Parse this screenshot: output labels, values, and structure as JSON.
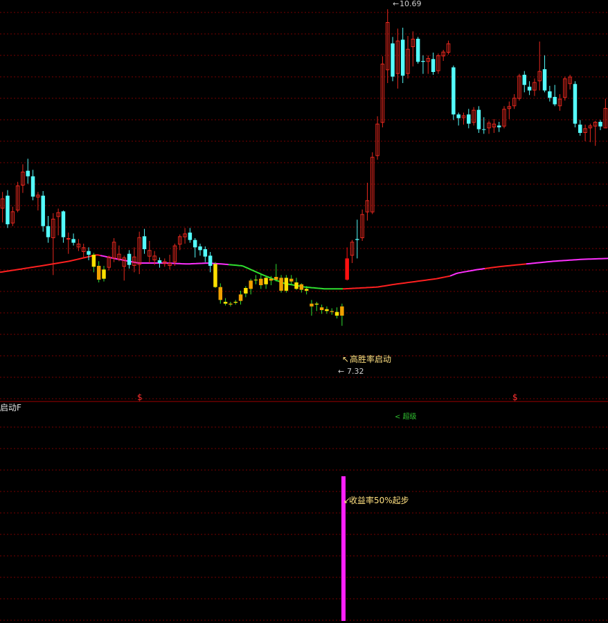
{
  "chart_data": {
    "type": "candlestick",
    "price_range": [
      6.5,
      10.85
    ],
    "indicator_range": [
      0,
      100
    ],
    "colors": {
      "up": "#e8281e",
      "down": "#54fcfc",
      "highlight_up": "#ff1010",
      "highlight_yellow": "#ffe000",
      "highlight_orange": "#f0a000",
      "ma_red": "#ff2020",
      "ma_magenta": "#ff30ff",
      "ma_green": "#30e030",
      "indicator_bar": "#ff20ff",
      "grid": "#7a0000",
      "divider": "#a00000",
      "label_text": "#ffe080",
      "axis_text": "#d0d0d0"
    },
    "max_label": "10.69",
    "min_label": "7.32",
    "signal_label": "高胜率启动",
    "indicator_label": "收益率50%起步",
    "lower_panel_title": "启动F",
    "lower_panel_note": "< 超级",
    "dollar_marks": [
      "$",
      "$"
    ],
    "indicator_value": 100,
    "candles": [
      {
        "o": 8.59,
        "h": 8.77,
        "l": 8.44,
        "c": 8.7,
        "cls": "up"
      },
      {
        "o": 8.73,
        "h": 8.79,
        "l": 8.38,
        "c": 8.42,
        "cls": "down"
      },
      {
        "o": 8.43,
        "h": 8.61,
        "l": 8.4,
        "c": 8.56,
        "cls": "up"
      },
      {
        "o": 8.57,
        "h": 8.88,
        "l": 8.55,
        "c": 8.84,
        "cls": "up"
      },
      {
        "o": 8.84,
        "h": 9.07,
        "l": 8.76,
        "c": 8.99,
        "cls": "up"
      },
      {
        "o": 9.0,
        "h": 9.13,
        "l": 8.86,
        "c": 8.94,
        "cls": "down"
      },
      {
        "o": 8.94,
        "h": 9.01,
        "l": 8.68,
        "c": 8.72,
        "cls": "down"
      },
      {
        "o": 8.71,
        "h": 8.77,
        "l": 8.57,
        "c": 8.74,
        "cls": "up"
      },
      {
        "o": 8.73,
        "h": 8.78,
        "l": 8.34,
        "c": 8.4,
        "cls": "down"
      },
      {
        "o": 8.4,
        "h": 8.51,
        "l": 8.22,
        "c": 8.28,
        "cls": "down"
      },
      {
        "o": 8.27,
        "h": 8.54,
        "l": 7.87,
        "c": 8.48,
        "cls": "up"
      },
      {
        "o": 8.5,
        "h": 8.59,
        "l": 8.3,
        "c": 8.55,
        "cls": "up"
      },
      {
        "o": 8.56,
        "h": 8.57,
        "l": 8.22,
        "c": 8.28,
        "cls": "down"
      },
      {
        "o": 8.27,
        "h": 8.33,
        "l": 8.1,
        "c": 8.26,
        "cls": "up"
      },
      {
        "o": 8.26,
        "h": 8.32,
        "l": 8.19,
        "c": 8.22,
        "cls": "down"
      },
      {
        "o": 8.21,
        "h": 8.26,
        "l": 8.13,
        "c": 8.17,
        "cls": "up"
      },
      {
        "o": 8.17,
        "h": 8.21,
        "l": 8.05,
        "c": 8.12,
        "cls": "up"
      },
      {
        "o": 8.13,
        "h": 8.17,
        "l": 8.03,
        "c": 8.09,
        "cls": "down"
      },
      {
        "o": 8.09,
        "h": 8.11,
        "l": 7.9,
        "c": 7.96,
        "cls": "hy"
      },
      {
        "o": 7.97,
        "h": 8.02,
        "l": 7.79,
        "c": 7.82,
        "cls": "hy"
      },
      {
        "o": 7.83,
        "h": 7.97,
        "l": 7.8,
        "c": 7.93,
        "cls": "hy"
      },
      {
        "o": 7.95,
        "h": 8.08,
        "l": 7.92,
        "c": 8.07,
        "cls": "up"
      },
      {
        "o": 8.05,
        "h": 8.27,
        "l": 8.01,
        "c": 8.23,
        "cls": "up"
      },
      {
        "o": 8.1,
        "h": 8.19,
        "l": 8.02,
        "c": 8.04,
        "cls": "up"
      },
      {
        "o": 8.06,
        "h": 8.08,
        "l": 7.81,
        "c": 7.96,
        "cls": "up"
      },
      {
        "o": 7.98,
        "h": 8.14,
        "l": 7.94,
        "c": 8.1,
        "cls": "down"
      },
      {
        "o": 8.07,
        "h": 8.17,
        "l": 7.9,
        "c": 7.97,
        "cls": "up"
      },
      {
        "o": 7.98,
        "h": 8.34,
        "l": 7.88,
        "c": 8.28,
        "cls": "up"
      },
      {
        "o": 8.29,
        "h": 8.37,
        "l": 8.1,
        "c": 8.15,
        "cls": "down"
      },
      {
        "o": 8.14,
        "h": 8.24,
        "l": 8.0,
        "c": 8.07,
        "cls": "up"
      },
      {
        "o": 8.08,
        "h": 8.13,
        "l": 7.98,
        "c": 8.03,
        "cls": "up"
      },
      {
        "o": 8.0,
        "h": 8.06,
        "l": 7.95,
        "c": 8.03,
        "cls": "down"
      },
      {
        "o": 8.02,
        "h": 8.05,
        "l": 7.96,
        "c": 7.99,
        "cls": "up"
      },
      {
        "o": 7.97,
        "h": 8.09,
        "l": 7.93,
        "c": 8.0,
        "cls": "up"
      },
      {
        "o": 8.01,
        "h": 8.21,
        "l": 7.97,
        "c": 8.19,
        "cls": "up"
      },
      {
        "o": 8.2,
        "h": 8.31,
        "l": 8.14,
        "c": 8.29,
        "cls": "up"
      },
      {
        "o": 8.28,
        "h": 8.38,
        "l": 8.21,
        "c": 8.32,
        "cls": "up"
      },
      {
        "o": 8.33,
        "h": 8.38,
        "l": 8.22,
        "c": 8.25,
        "cls": "down"
      },
      {
        "o": 8.25,
        "h": 8.27,
        "l": 8.06,
        "c": 8.17,
        "cls": "down"
      },
      {
        "o": 8.18,
        "h": 8.21,
        "l": 8.08,
        "c": 8.14,
        "cls": "down"
      },
      {
        "o": 8.15,
        "h": 8.18,
        "l": 8.01,
        "c": 8.07,
        "cls": "down"
      },
      {
        "o": 8.08,
        "h": 8.12,
        "l": 7.9,
        "c": 7.97,
        "cls": "down"
      },
      {
        "o": 7.99,
        "h": 8.01,
        "l": 7.73,
        "c": 7.74,
        "cls": "hy"
      },
      {
        "o": 7.74,
        "h": 7.78,
        "l": 7.56,
        "c": 7.6,
        "cls": "hy"
      },
      {
        "o": 7.58,
        "h": 7.62,
        "l": 7.54,
        "c": 7.56,
        "cls": "hy"
      },
      {
        "o": 7.55,
        "h": 7.58,
        "l": 7.53,
        "c": 7.56,
        "cls": "hy"
      },
      {
        "o": 7.57,
        "h": 7.6,
        "l": 7.55,
        "c": 7.58,
        "cls": "hy"
      },
      {
        "o": 7.59,
        "h": 7.7,
        "l": 7.55,
        "c": 7.66,
        "cls": "hy"
      },
      {
        "o": 7.67,
        "h": 7.75,
        "l": 7.63,
        "c": 7.73,
        "cls": "hy"
      },
      {
        "o": 7.72,
        "h": 7.83,
        "l": 7.66,
        "c": 7.81,
        "cls": "hy"
      },
      {
        "o": 7.82,
        "h": 7.87,
        "l": 7.77,
        "c": 7.82,
        "cls": "hy"
      },
      {
        "o": 7.83,
        "h": 7.88,
        "l": 7.72,
        "c": 7.76,
        "cls": "hy"
      },
      {
        "o": 7.77,
        "h": 7.85,
        "l": 7.72,
        "c": 7.84,
        "cls": "hy"
      },
      {
        "o": 7.83,
        "h": 7.86,
        "l": 7.76,
        "c": 7.81,
        "cls": "hy"
      },
      {
        "o": 7.82,
        "h": 7.99,
        "l": 7.8,
        "c": 7.85,
        "cls": "ho"
      },
      {
        "o": 7.84,
        "h": 7.87,
        "l": 7.68,
        "c": 7.7,
        "cls": "hy"
      },
      {
        "o": 7.7,
        "h": 7.87,
        "l": 7.68,
        "c": 7.84,
        "cls": "hy"
      },
      {
        "o": 7.83,
        "h": 7.87,
        "l": 7.76,
        "c": 7.8,
        "cls": "hy"
      },
      {
        "o": 7.79,
        "h": 7.84,
        "l": 7.71,
        "c": 7.72,
        "cls": "hy"
      },
      {
        "o": 7.71,
        "h": 7.78,
        "l": 7.68,
        "c": 7.77,
        "cls": "hy"
      },
      {
        "o": 7.72,
        "h": 7.75,
        "l": 7.66,
        "c": 7.7,
        "cls": "hy"
      },
      {
        "o": 7.56,
        "h": 7.6,
        "l": 7.43,
        "c": 7.53,
        "cls": "hy"
      },
      {
        "o": 7.56,
        "h": 7.58,
        "l": 7.48,
        "c": 7.55,
        "cls": "hy"
      },
      {
        "o": 7.52,
        "h": 7.55,
        "l": 7.45,
        "c": 7.49,
        "cls": "hy"
      },
      {
        "o": 7.5,
        "h": 7.53,
        "l": 7.45,
        "c": 7.48,
        "cls": "hy"
      },
      {
        "o": 7.48,
        "h": 7.51,
        "l": 7.44,
        "c": 7.47,
        "cls": "hy"
      },
      {
        "o": 7.47,
        "h": 7.52,
        "l": 7.4,
        "c": 7.43,
        "cls": "hy"
      },
      {
        "o": 7.43,
        "h": 7.56,
        "l": 7.32,
        "c": 7.53,
        "cls": "hy"
      },
      {
        "o": 7.82,
        "h": 8.17,
        "l": 7.81,
        "c": 8.05,
        "cls": "hr"
      },
      {
        "o": 8.08,
        "h": 8.25,
        "l": 8.0,
        "c": 8.23,
        "cls": "up"
      },
      {
        "o": 8.26,
        "h": 8.47,
        "l": 8.05,
        "c": 8.25,
        "cls": "down"
      },
      {
        "o": 8.27,
        "h": 8.58,
        "l": 8.24,
        "c": 8.53,
        "cls": "up"
      },
      {
        "o": 8.55,
        "h": 8.87,
        "l": 8.46,
        "c": 8.68,
        "cls": "up"
      },
      {
        "o": 8.55,
        "h": 9.2,
        "l": 8.53,
        "c": 9.15,
        "cls": "up"
      },
      {
        "o": 9.16,
        "h": 9.59,
        "l": 9.12,
        "c": 9.51,
        "cls": "up"
      },
      {
        "o": 9.52,
        "h": 10.24,
        "l": 9.47,
        "c": 10.16,
        "cls": "up"
      },
      {
        "o": 10.09,
        "h": 10.75,
        "l": 9.95,
        "c": 10.61,
        "cls": "up"
      },
      {
        "o": 10.38,
        "h": 10.45,
        "l": 9.97,
        "c": 10.02,
        "cls": "down"
      },
      {
        "o": 10.05,
        "h": 10.54,
        "l": 9.89,
        "c": 10.41,
        "cls": "up"
      },
      {
        "o": 10.42,
        "h": 10.55,
        "l": 9.95,
        "c": 10.03,
        "cls": "down"
      },
      {
        "o": 10.05,
        "h": 10.46,
        "l": 10.0,
        "c": 10.32,
        "cls": "up"
      },
      {
        "o": 10.34,
        "h": 10.51,
        "l": 10.13,
        "c": 10.43,
        "cls": "up"
      },
      {
        "o": 10.43,
        "h": 10.45,
        "l": 10.16,
        "c": 10.18,
        "cls": "down"
      },
      {
        "o": 10.18,
        "h": 10.25,
        "l": 10.05,
        "c": 10.19,
        "cls": "down"
      },
      {
        "o": 10.18,
        "h": 10.25,
        "l": 10.05,
        "c": 10.22,
        "cls": "up"
      },
      {
        "o": 10.21,
        "h": 10.28,
        "l": 10.04,
        "c": 10.07,
        "cls": "down"
      },
      {
        "o": 10.08,
        "h": 10.27,
        "l": 10.05,
        "c": 10.25,
        "cls": "up"
      },
      {
        "o": 10.24,
        "h": 10.31,
        "l": 10.19,
        "c": 10.29,
        "cls": "up"
      },
      {
        "o": 10.28,
        "h": 10.41,
        "l": 10.26,
        "c": 10.38,
        "cls": "up"
      },
      {
        "o": 10.12,
        "h": 10.14,
        "l": 9.55,
        "c": 9.61,
        "cls": "down"
      },
      {
        "o": 9.61,
        "h": 9.63,
        "l": 9.49,
        "c": 9.57,
        "cls": "down"
      },
      {
        "o": 9.57,
        "h": 9.63,
        "l": 9.5,
        "c": 9.6,
        "cls": "up"
      },
      {
        "o": 9.61,
        "h": 9.67,
        "l": 9.46,
        "c": 9.51,
        "cls": "down"
      },
      {
        "o": 9.52,
        "h": 9.69,
        "l": 9.49,
        "c": 9.66,
        "cls": "up"
      },
      {
        "o": 9.66,
        "h": 9.7,
        "l": 9.41,
        "c": 9.45,
        "cls": "down"
      },
      {
        "o": 9.45,
        "h": 9.58,
        "l": 9.4,
        "c": 9.45,
        "cls": "down"
      },
      {
        "o": 9.46,
        "h": 9.54,
        "l": 9.4,
        "c": 9.52,
        "cls": "up"
      },
      {
        "o": 9.51,
        "h": 9.56,
        "l": 9.41,
        "c": 9.47,
        "cls": "up"
      },
      {
        "o": 9.47,
        "h": 9.53,
        "l": 9.42,
        "c": 9.49,
        "cls": "down"
      },
      {
        "o": 9.48,
        "h": 9.7,
        "l": 9.46,
        "c": 9.67,
        "cls": "up"
      },
      {
        "o": 9.67,
        "h": 9.75,
        "l": 9.56,
        "c": 9.7,
        "cls": "up"
      },
      {
        "o": 9.7,
        "h": 9.83,
        "l": 9.67,
        "c": 9.79,
        "cls": "up"
      },
      {
        "o": 9.78,
        "h": 10.05,
        "l": 9.76,
        "c": 10.03,
        "cls": "up"
      },
      {
        "o": 10.04,
        "h": 10.08,
        "l": 9.85,
        "c": 9.93,
        "cls": "down"
      },
      {
        "o": 9.91,
        "h": 9.97,
        "l": 9.82,
        "c": 9.87,
        "cls": "down"
      },
      {
        "o": 9.87,
        "h": 10.0,
        "l": 9.81,
        "c": 9.96,
        "cls": "up"
      },
      {
        "o": 9.97,
        "h": 10.4,
        "l": 9.87,
        "c": 10.08,
        "cls": "up"
      },
      {
        "o": 10.1,
        "h": 10.25,
        "l": 9.85,
        "c": 9.87,
        "cls": "down"
      },
      {
        "o": 9.86,
        "h": 9.92,
        "l": 9.75,
        "c": 9.79,
        "cls": "down"
      },
      {
        "o": 9.8,
        "h": 9.93,
        "l": 9.7,
        "c": 9.72,
        "cls": "down"
      },
      {
        "o": 9.7,
        "h": 9.83,
        "l": 9.65,
        "c": 9.78,
        "cls": "up"
      },
      {
        "o": 9.79,
        "h": 10.02,
        "l": 9.76,
        "c": 10.0,
        "cls": "up"
      },
      {
        "o": 10.02,
        "h": 10.04,
        "l": 9.88,
        "c": 9.94,
        "cls": "up"
      },
      {
        "o": 9.94,
        "h": 9.97,
        "l": 9.47,
        "c": 9.51,
        "cls": "down"
      },
      {
        "o": 9.5,
        "h": 9.55,
        "l": 9.38,
        "c": 9.41,
        "cls": "down"
      },
      {
        "o": 9.41,
        "h": 9.5,
        "l": 9.32,
        "c": 9.46,
        "cls": "up"
      },
      {
        "o": 9.46,
        "h": 9.51,
        "l": 9.31,
        "c": 9.49,
        "cls": "up"
      },
      {
        "o": 9.48,
        "h": 9.54,
        "l": 9.27,
        "c": 9.53,
        "cls": "up"
      },
      {
        "o": 9.53,
        "h": 9.55,
        "l": 9.44,
        "c": 9.48,
        "cls": "down"
      },
      {
        "o": 9.46,
        "h": 9.78,
        "l": 9.46,
        "c": 9.68,
        "cls": "up"
      }
    ],
    "ma_points": [
      [
        0,
        7.9
      ],
      [
        60,
        7.97
      ],
      [
        100,
        8.02
      ],
      [
        140,
        8.09
      ],
      [
        165,
        8.05
      ],
      [
        200,
        8.0
      ],
      [
        240,
        8.0
      ],
      [
        270,
        7.99
      ],
      [
        300,
        8.0
      ],
      [
        320,
        7.99
      ],
      [
        350,
        7.97
      ],
      [
        380,
        7.87
      ],
      [
        410,
        7.78
      ],
      [
        440,
        7.74
      ],
      [
        470,
        7.72
      ],
      [
        495,
        7.72
      ],
      [
        520,
        7.73
      ],
      [
        545,
        7.74
      ],
      [
        570,
        7.77
      ],
      [
        600,
        7.8
      ],
      [
        630,
        7.83
      ],
      [
        650,
        7.86
      ],
      [
        660,
        7.89
      ],
      [
        690,
        7.93
      ],
      [
        720,
        7.96
      ],
      [
        760,
        7.99
      ],
      [
        800,
        8.02
      ],
      [
        840,
        8.04
      ],
      [
        878,
        8.05
      ]
    ],
    "ma_segments": [
      {
        "from": 0,
        "to": 145,
        "cls": "red"
      },
      {
        "from": 145,
        "to": 330,
        "cls": "magenta"
      },
      {
        "from": 330,
        "to": 495,
        "cls": "green"
      },
      {
        "from": 495,
        "to": 650,
        "cls": "red"
      },
      {
        "from": 650,
        "to": 700,
        "cls": "magenta"
      },
      {
        "from": 700,
        "to": 760,
        "cls": "red"
      },
      {
        "from": 760,
        "to": 878,
        "cls": "magenta"
      }
    ]
  }
}
